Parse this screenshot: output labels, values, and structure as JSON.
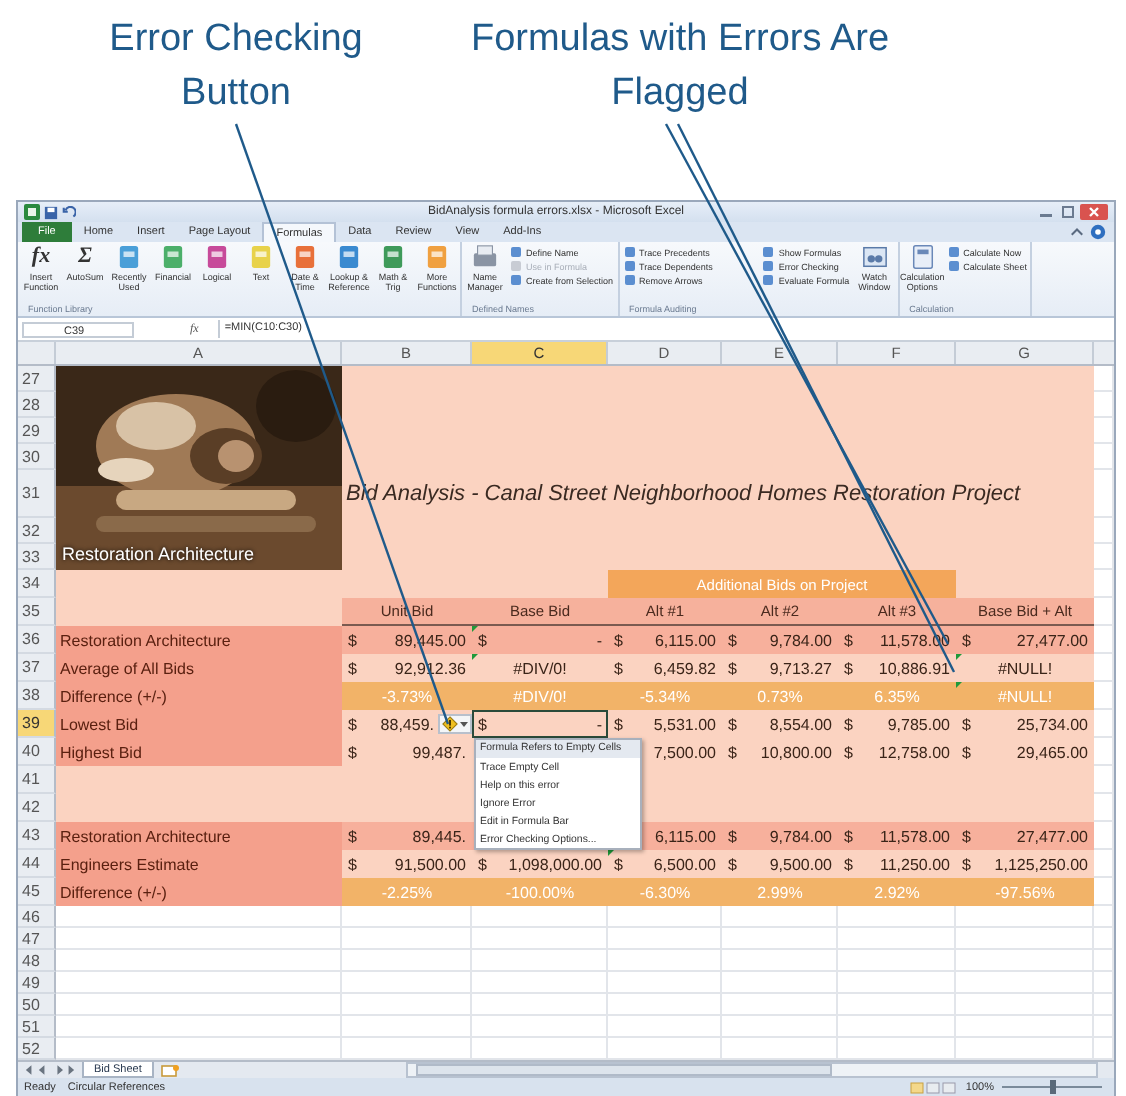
{
  "callouts": [
    {
      "text": "Error Checking Button"
    },
    {
      "text": "Formulas with Errors Are Flagged"
    }
  ],
  "window": {
    "title": "BidAnalysis formula errors.xlsx - Microsoft Excel"
  },
  "tabs": [
    {
      "label": "File",
      "kind": "file",
      "selected": false
    },
    {
      "label": "Home",
      "kind": "tab",
      "selected": false
    },
    {
      "label": "Insert",
      "kind": "tab",
      "selected": false
    },
    {
      "label": "Page Layout",
      "kind": "tab",
      "selected": false
    },
    {
      "label": "Formulas",
      "kind": "tab",
      "selected": true
    },
    {
      "label": "Data",
      "kind": "tab",
      "selected": false
    },
    {
      "label": "Review",
      "kind": "tab",
      "selected": false
    },
    {
      "label": "View",
      "kind": "tab",
      "selected": false
    },
    {
      "label": "Add-Ins",
      "kind": "tab",
      "selected": false
    }
  ],
  "ribbon": [
    {
      "label": "Function Library",
      "items": [
        {
          "kind": "glyph",
          "glyph": "fx",
          "label": "Insert Function",
          "disabled": false
        },
        {
          "kind": "glyph",
          "glyph": "Σ",
          "label": "AutoSum",
          "disabled": false
        },
        {
          "kind": "book",
          "color": "#4a9fd8",
          "label": "Recently Used",
          "disabled": false
        },
        {
          "kind": "book",
          "color": "#4caf6a",
          "label": "Financial",
          "disabled": false
        },
        {
          "kind": "book",
          "color": "#c74a9a",
          "label": "Logical",
          "disabled": false
        },
        {
          "kind": "book",
          "color": "#e8d24a",
          "label": "Text",
          "disabled": false
        },
        {
          "kind": "book",
          "color": "#e8703a",
          "label": "Date & Time",
          "disabled": false
        },
        {
          "kind": "book",
          "color": "#3a8ad0",
          "label": "Lookup & Reference",
          "disabled": false
        },
        {
          "kind": "book",
          "color": "#3f9a5a",
          "label": "Math & Trig",
          "disabled": false
        },
        {
          "kind": "book",
          "color": "#f0a040",
          "label": "More Functions",
          "disabled": false
        }
      ]
    },
    {
      "label": "Defined Names",
      "items": [
        {
          "kind": "manager",
          "label": "Name Manager",
          "disabled": false
        },
        {
          "kind": "small",
          "label": "Define Name",
          "disabled": false
        },
        {
          "kind": "small",
          "label": "Use in Formula",
          "disabled": true
        },
        {
          "kind": "small",
          "label": "Create from Selection",
          "disabled": false
        }
      ]
    },
    {
      "label": "Formula Auditing",
      "items": [
        {
          "kind": "small",
          "label": "Trace Precedents",
          "disabled": false
        },
        {
          "kind": "small",
          "label": "Trace Dependents",
          "disabled": false
        },
        {
          "kind": "small",
          "label": "Remove Arrows",
          "disabled": false
        },
        {
          "kind": "small",
          "label": "Show Formulas",
          "disabled": false
        },
        {
          "kind": "small",
          "label": "Error Checking",
          "disabled": false
        },
        {
          "kind": "small",
          "label": "Evaluate Formula",
          "disabled": false
        },
        {
          "kind": "watch",
          "label": "Watch Window",
          "disabled": false
        }
      ]
    },
    {
      "label": "Calculation",
      "items": [
        {
          "kind": "options",
          "label": "Calculation Options",
          "disabled": false
        },
        {
          "kind": "small",
          "label": "Calculate Now",
          "disabled": false
        },
        {
          "kind": "small",
          "label": "Calculate Sheet",
          "disabled": false
        }
      ]
    }
  ],
  "formula_bar": {
    "name_box": "C39",
    "fx": "fx",
    "formula": "=MIN(C10:C30)"
  },
  "sheet": {
    "columns": [
      {
        "label": "A",
        "selected": false
      },
      {
        "label": "B",
        "selected": false
      },
      {
        "label": "C",
        "selected": true
      },
      {
        "label": "D",
        "selected": false
      },
      {
        "label": "E",
        "selected": false
      },
      {
        "label": "F",
        "selected": false
      },
      {
        "label": "G",
        "selected": false
      }
    ],
    "picture": {
      "kind": "picture",
      "caption": "Restoration Architecture"
    },
    "rows": [
      {
        "num": "27",
        "kind": "top",
        "selected": false
      },
      {
        "num": "28",
        "kind": "top",
        "selected": false
      },
      {
        "num": "29",
        "kind": "top",
        "selected": false
      },
      {
        "num": "30",
        "kind": "top",
        "selected": false
      },
      {
        "num": "31",
        "kind": "title",
        "selected": false,
        "title": "Bid Analysis - Canal Street Neighborhood Homes Restoration Project"
      },
      {
        "num": "32",
        "kind": "top",
        "selected": false
      },
      {
        "num": "33",
        "kind": "top",
        "selected": false
      },
      {
        "num": "34",
        "kind": "banner",
        "selected": false,
        "banner": "Additional Bids on Project"
      },
      {
        "num": "35",
        "kind": "header",
        "selected": false,
        "cells": [
          "Unit Bid",
          "Base Bid",
          "Alt #1",
          "Alt #2",
          "Alt #3",
          "Base Bid + Alt"
        ]
      },
      {
        "num": "36",
        "kind": "data",
        "color": "#f7b09c",
        "selected": false,
        "label": "Restoration Architecture",
        "cells": [
          {
            "kind": "currency",
            "sym": "$",
            "value": "89,445.00",
            "flagged": false
          },
          {
            "kind": "currency",
            "sym": "$",
            "value": "-",
            "flagged": true
          },
          {
            "kind": "currency",
            "sym": "$",
            "value": "6,115.00",
            "flagged": false
          },
          {
            "kind": "currency",
            "sym": "$",
            "value": "9,784.00",
            "flagged": false
          },
          {
            "kind": "currency",
            "sym": "$",
            "value": "11,578.00",
            "flagged": false
          },
          {
            "kind": "currency",
            "sym": "$",
            "value": "27,477.00",
            "flagged": false
          }
        ]
      },
      {
        "num": "37",
        "kind": "data",
        "color": "#fbd3c1",
        "selected": false,
        "label": "Average of All Bids",
        "cells": [
          {
            "kind": "currency",
            "sym": "$",
            "value": "92,912.36",
            "flagged": false
          },
          {
            "kind": "centered",
            "value": "#DIV/0!",
            "flagged": true
          },
          {
            "kind": "currency",
            "sym": "$",
            "value": "6,459.82",
            "flagged": false
          },
          {
            "kind": "currency",
            "sym": "$",
            "value": "9,713.27",
            "flagged": false
          },
          {
            "kind": "currency",
            "sym": "$",
            "value": "10,886.91",
            "flagged": false
          },
          {
            "kind": "centered",
            "value": "#NULL!",
            "flagged": true
          }
        ]
      },
      {
        "num": "38",
        "kind": "percent",
        "color": "#f2b368",
        "selected": false,
        "label": "Difference (+/-)",
        "cells": [
          {
            "kind": "centered",
            "value": "-3.73%",
            "flagged": false
          },
          {
            "kind": "centered",
            "value": "#DIV/0!",
            "flagged": false
          },
          {
            "kind": "centered",
            "value": "-5.34%",
            "flagged": false
          },
          {
            "kind": "centered",
            "value": "0.73%",
            "flagged": false
          },
          {
            "kind": "centered",
            "value": "6.35%",
            "flagged": false
          },
          {
            "kind": "centered",
            "value": "#NULL!",
            "flagged": true
          }
        ]
      },
      {
        "num": "39",
        "kind": "data",
        "color": "#fbd3c1",
        "selected": true,
        "label": "Lowest Bid",
        "cells": [
          {
            "kind": "currency",
            "sym": "$",
            "value": "88,459.",
            "flagged": false
          },
          {
            "kind": "currency",
            "sym": "$",
            "value": "-",
            "flagged": false
          },
          {
            "kind": "currency",
            "sym": "$",
            "value": "5,531.00",
            "flagged": false
          },
          {
            "kind": "currency",
            "sym": "$",
            "value": "8,554.00",
            "flagged": false
          },
          {
            "kind": "currency",
            "sym": "$",
            "value": "9,785.00",
            "flagged": false
          },
          {
            "kind": "currency",
            "sym": "$",
            "value": "25,734.00",
            "flagged": false
          }
        ]
      },
      {
        "num": "40",
        "kind": "data",
        "color": "#fbd3c1",
        "selected": false,
        "label": "Highest Bid",
        "cells": [
          {
            "kind": "currency",
            "sym": "$",
            "value": "99,487.",
            "flagged": false
          },
          {
            "kind": "empty"
          },
          {
            "kind": "number",
            "value": "7,500.00",
            "flagged": false
          },
          {
            "kind": "currency",
            "sym": "$",
            "value": "10,800.00",
            "flagged": false
          },
          {
            "kind": "currency",
            "sym": "$",
            "value": "12,758.00",
            "flagged": false
          },
          {
            "kind": "currency",
            "sym": "$",
            "value": "29,465.00",
            "flagged": false
          }
        ]
      },
      {
        "num": "41",
        "kind": "spacer",
        "selected": false
      },
      {
        "num": "42",
        "kind": "spacer",
        "selected": false
      },
      {
        "num": "43",
        "kind": "data",
        "color": "#f7b09c",
        "selected": false,
        "label": "Restoration Architecture",
        "cells": [
          {
            "kind": "currency",
            "sym": "$",
            "value": "89,445.",
            "flagged": false
          },
          {
            "kind": "empty"
          },
          {
            "kind": "number",
            "value": "6,115.00",
            "flagged": false
          },
          {
            "kind": "currency",
            "sym": "$",
            "value": "9,784.00",
            "flagged": false
          },
          {
            "kind": "currency",
            "sym": "$",
            "value": "11,578.00",
            "flagged": false
          },
          {
            "kind": "currency",
            "sym": "$",
            "value": "27,477.00",
            "flagged": false
          }
        ]
      },
      {
        "num": "44",
        "kind": "data",
        "color": "#fbd3c1",
        "selected": false,
        "label": "Engineers Estimate",
        "cells": [
          {
            "kind": "currency",
            "sym": "$",
            "value": "91,500.00",
            "flagged": false
          },
          {
            "kind": "currency",
            "sym": "$",
            "value": "1,098,000.00",
            "flagged": false
          },
          {
            "kind": "currency",
            "sym": "$",
            "value": "6,500.00",
            "flagged": true
          },
          {
            "kind": "currency",
            "sym": "$",
            "value": "9,500.00",
            "flagged": false
          },
          {
            "kind": "currency",
            "sym": "$",
            "value": "11,250.00",
            "flagged": false
          },
          {
            "kind": "currency",
            "sym": "$",
            "value": "1,125,250.00",
            "flagged": false
          }
        ]
      },
      {
        "num": "45",
        "kind": "percent",
        "color": "#f2b368",
        "selected": false,
        "label": "Difference (+/-)",
        "cells": [
          {
            "kind": "centered",
            "value": "-2.25%",
            "flagged": false
          },
          {
            "kind": "centered",
            "value": "-100.00%",
            "flagged": false
          },
          {
            "kind": "centered",
            "value": "-6.30%",
            "flagged": false
          },
          {
            "kind": "centered",
            "value": "2.99%",
            "flagged": false
          },
          {
            "kind": "centered",
            "value": "2.92%",
            "flagged": false
          },
          {
            "kind": "centered",
            "value": "-97.56%",
            "flagged": false
          }
        ]
      },
      {
        "num": "46",
        "kind": "empty",
        "selected": false
      },
      {
        "num": "47",
        "kind": "empty",
        "selected": false
      },
      {
        "num": "48",
        "kind": "empty",
        "selected": false
      },
      {
        "num": "49",
        "kind": "empty",
        "selected": false
      },
      {
        "num": "50",
        "kind": "empty",
        "selected": false
      },
      {
        "num": "51",
        "kind": "empty",
        "selected": false
      },
      {
        "num": "52",
        "kind": "empty",
        "selected": false
      }
    ],
    "error_menu": [
      {
        "label": "Formula Refers to Empty Cells",
        "kind": "header"
      },
      {
        "label": "Trace Empty Cell",
        "kind": "item"
      },
      {
        "label": "Help on this error",
        "kind": "item"
      },
      {
        "label": "Ignore Error",
        "kind": "item"
      },
      {
        "label": "Edit in Formula Bar",
        "kind": "item"
      },
      {
        "label": "Error Checking Options...",
        "kind": "item"
      }
    ]
  },
  "sheet_tabs": [
    {
      "label": "Bid Sheet",
      "selected": true
    }
  ],
  "status_bar": {
    "items": [
      "Ready",
      "Circular References"
    ],
    "zoom": {
      "label": "100%",
      "level": 0.5
    }
  }
}
